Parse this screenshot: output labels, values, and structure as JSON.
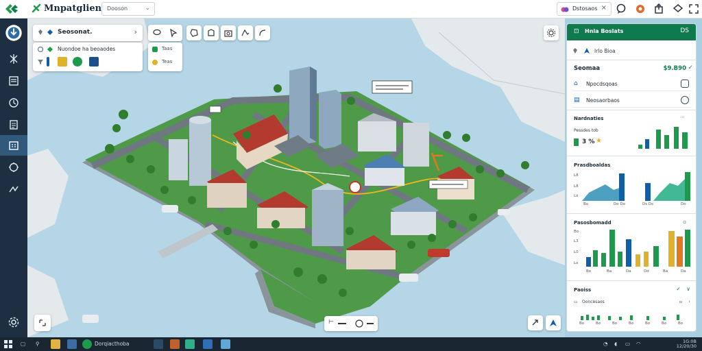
{
  "topbar": {
    "app_title": "Mnpatglienaia",
    "select_value": "Dooson",
    "right_chip_label": "Dstosaos"
  },
  "leftrail": {
    "items": [
      {
        "icon": "home-icon"
      },
      {
        "icon": "network-icon"
      },
      {
        "icon": "document-icon"
      },
      {
        "icon": "history-icon"
      },
      {
        "icon": "report-icon"
      },
      {
        "icon": "building-icon"
      },
      {
        "icon": "location-icon"
      },
      {
        "icon": "routes-icon"
      },
      {
        "icon": "settings-icon"
      }
    ],
    "active_index": 5
  },
  "map_panels": {
    "search_label": "Seosonat.",
    "layers_label": "Nuondoe ha beoaodes",
    "legend_rows": [
      "Taas",
      "Teas"
    ]
  },
  "right_panel": {
    "header_title": "Hnla Boslats",
    "header_code": "DS",
    "subheader": "Irlo Bioa",
    "section_title": "Seomaa",
    "section_value": "$9.B90",
    "rows": [
      {
        "label": "Npocdsqoas"
      },
      {
        "label": "Neosaorbaos"
      }
    ],
    "chart1": {
      "title": "Nardnaties",
      "sub_label": "Pessdes tob",
      "metric": "3 %",
      "colors": {
        "green": "#1e9a4d",
        "blue": "#0e5ea8"
      }
    },
    "chart2": {
      "title": "Prasdboaldas",
      "y_labels": [
        "L8",
        "L8",
        "Lo"
      ],
      "x_labels": [
        "Bo",
        "Do Do",
        "Ds Ds",
        "Do"
      ]
    },
    "chart3": {
      "title": "Pasosbomadd",
      "y_labels": [
        "Bo",
        "L3",
        "L0",
        "Lo"
      ],
      "x_labels": [
        "Bo",
        "Ba",
        "Da",
        "Dd",
        "Ba",
        "Da"
      ]
    },
    "footer": {
      "title": "Paoiss",
      "row_label": "Ooncesaos",
      "scale_labels": [
        "Bo",
        "Bo",
        "Bo",
        "Bo",
        "Bo",
        "Bo",
        "Bo"
      ]
    }
  },
  "taskbar": {
    "active_label": "Dorqiacthoba",
    "clock_line1": "1G:0B",
    "clock_line2": "12/20/30"
  },
  "colors": {
    "accent_green": "#0f7a4d",
    "rail_bg": "#1d2f40",
    "water": "#b4d6e6",
    "land": "#e6ebee"
  }
}
